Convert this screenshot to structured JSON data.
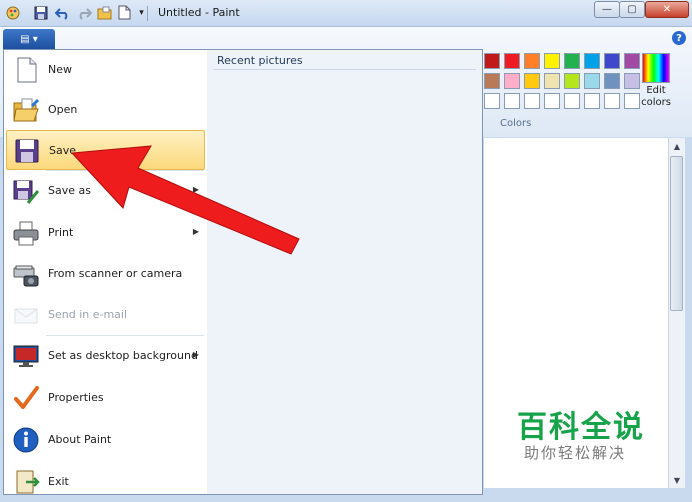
{
  "window": {
    "title": "Untitled - Paint",
    "minimize_glyph": "—",
    "maximize_glyph": "▢",
    "close_glyph": "✕"
  },
  "quick_access": {
    "paint_icon": "paint-app-icon",
    "save_icon": "save-icon",
    "undo_icon": "undo-icon",
    "redo_icon": "redo-icon",
    "open_icon": "open-folder-icon",
    "new_icon": "new-document-icon",
    "customize_glyph": "▾"
  },
  "app_button": {
    "glyph": "▤ ▾"
  },
  "help": {
    "glyph": "?"
  },
  "app_menu": {
    "items": [
      {
        "label": "New",
        "icon": "new-document-icon"
      },
      {
        "label": "Open",
        "icon": "open-folder-icon"
      },
      {
        "label": "Save",
        "icon": "floppy-disk-icon",
        "highlighted": true
      },
      {
        "label": "Save as",
        "icon": "save-as-icon",
        "has_submenu": true
      },
      {
        "label": "Print",
        "icon": "printer-icon",
        "has_submenu": true
      },
      {
        "label": "From scanner or camera",
        "icon": "scanner-icon"
      },
      {
        "label": "Send in e-mail",
        "icon": "email-icon",
        "disabled": true
      },
      {
        "label": "Set as desktop background",
        "icon": "desktop-background-icon",
        "has_submenu": true
      },
      {
        "label": "Properties",
        "icon": "checkmark-icon"
      },
      {
        "label": "About Paint",
        "icon": "info-icon"
      },
      {
        "label": "Exit",
        "icon": "exit-icon"
      }
    ],
    "submenu_glyph": "▶",
    "recent_title": "Recent pictures"
  },
  "colors": {
    "label": "Colors",
    "edit_colors_label": "Edit colors",
    "row1": [
      "#c01a1a",
      "#ef1c24",
      "#ff7f27",
      "#fff200",
      "#22b14c",
      "#00a2e8",
      "#3f48cc",
      "#a349a4"
    ],
    "row2": [
      "#b97a57",
      "#ffaec9",
      "#ffc90e",
      "#efe4b0",
      "#b5e61d",
      "#99d9ea",
      "#7092be",
      "#c8bfe7"
    ],
    "row3": [
      "#ffffff",
      "#ffffff",
      "#ffffff",
      "#ffffff",
      "#ffffff",
      "#ffffff",
      "#ffffff",
      "#ffffff"
    ]
  },
  "annotation": {
    "color": "#ee1c1c",
    "points_to": "Save"
  },
  "watermark": {
    "main": "百科全说",
    "sub": "助你轻松解决",
    "main_color": "#16a34a"
  }
}
